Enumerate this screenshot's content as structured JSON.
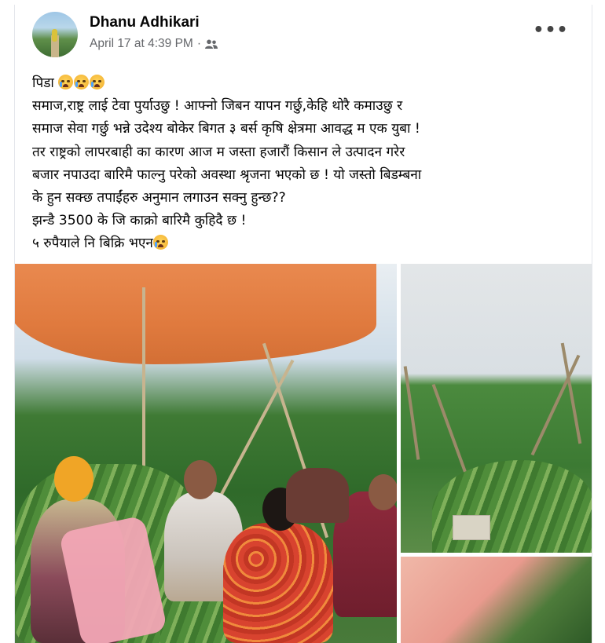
{
  "post": {
    "author": "Dhanu Adhikari",
    "timestamp": "April 17 at 4:39 PM",
    "separator": "·",
    "audience_icon": "friends-icon",
    "more_label": "•••",
    "text_lines": [
      "पिडा",
      "समाज,राष्ट्र लाई टेवा पुर्याउछु ! आफ्नो जिबन यापन गर्छु,केहि थोरै कमाउछु र",
      "समाज सेवा गर्छु भन्ने उदेश्य बोकेर बिगत ३ बर्स कृषि क्षेत्रमा आवद्ध म एक युबा !",
      "तर राष्ट्रको लापरबाही का कारण आज म जस्ता हजारौं किसान ले उत्पादन गरेर",
      "बजार नपाउदा बारिमै फाल्नु परेको अवस्था श्रृजना भएको छ ! यो जस्तो बिडम्बना",
      "के हुन सक्छ तपाईंहरु अनुमान लगाउन सक्नु हुन्छ??",
      "झन्डै 3500 के जि काक्रो बारिमै कुहिदै छ !",
      "५ रुपैयाले नि बिक्रि भएन"
    ],
    "emoji_names": [
      "loudly-crying-face",
      "loudly-crying-face",
      "loudly-crying-face",
      "sad-relieved-face"
    ]
  },
  "photos": {
    "main_alt_icon": "photo-women-sorting-cucumbers",
    "right_top_icon": "photo-cucumber-field-pile",
    "right_bottom_icon": "photo-pink-sacks"
  },
  "colors": {
    "name": "#050505",
    "meta": "#65676b",
    "tarp": "#e07a3e"
  }
}
